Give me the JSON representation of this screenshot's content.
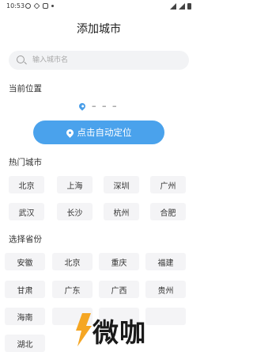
{
  "status_bar": {
    "time": "10:53"
  },
  "header": {
    "title": "添加城市"
  },
  "search": {
    "placeholder": "输入城市名"
  },
  "current_location": {
    "section_title": "当前位置",
    "value": "– – –",
    "locate_button_label": "点击自动定位"
  },
  "hot_cities": {
    "section_title": "热门城市",
    "items": [
      "北京",
      "上海",
      "深圳",
      "广州",
      "武汉",
      "长沙",
      "杭州",
      "合肥"
    ]
  },
  "provinces": {
    "section_title": "选择省份",
    "items": [
      "安徽",
      "北京",
      "重庆",
      "福建",
      "甘肃",
      "广东",
      "广西",
      "贵州",
      "海南",
      "",
      "",
      "",
      "湖北"
    ]
  },
  "colors": {
    "accent": "#4aa2ec",
    "chip_bg": "#f4f4f6",
    "search_bg": "#f2f3f5"
  },
  "watermark": {
    "text": "微咖"
  }
}
